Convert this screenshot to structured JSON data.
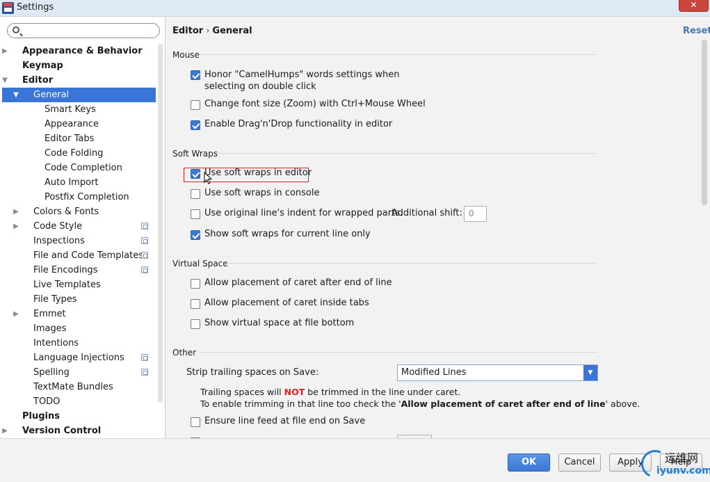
{
  "window": {
    "title": "Settings",
    "close_label": "✕"
  },
  "search": {
    "placeholder": ""
  },
  "tree": {
    "items": [
      {
        "label": "Appearance & Behavior",
        "arrow": "▶",
        "bold": true,
        "indent": 0,
        "project": false
      },
      {
        "label": "Keymap",
        "arrow": "",
        "bold": true,
        "indent": 0,
        "project": false
      },
      {
        "label": "Editor",
        "arrow": "▼",
        "bold": true,
        "indent": 0,
        "project": false
      },
      {
        "label": "General",
        "arrow": "▼",
        "bold": false,
        "indent": 1,
        "project": false,
        "selected": true
      },
      {
        "label": "Smart Keys",
        "arrow": "",
        "bold": false,
        "indent": 2,
        "project": false
      },
      {
        "label": "Appearance",
        "arrow": "",
        "bold": false,
        "indent": 2,
        "project": false
      },
      {
        "label": "Editor Tabs",
        "arrow": "",
        "bold": false,
        "indent": 2,
        "project": false
      },
      {
        "label": "Code Folding",
        "arrow": "",
        "bold": false,
        "indent": 2,
        "project": false
      },
      {
        "label": "Code Completion",
        "arrow": "",
        "bold": false,
        "indent": 2,
        "project": false
      },
      {
        "label": "Auto Import",
        "arrow": "",
        "bold": false,
        "indent": 2,
        "project": false
      },
      {
        "label": "Postfix Completion",
        "arrow": "",
        "bold": false,
        "indent": 2,
        "project": false
      },
      {
        "label": "Colors & Fonts",
        "arrow": "▶",
        "bold": false,
        "indent": 1,
        "project": false
      },
      {
        "label": "Code Style",
        "arrow": "▶",
        "bold": false,
        "indent": 1,
        "project": true
      },
      {
        "label": "Inspections",
        "arrow": "",
        "bold": false,
        "indent": 1,
        "project": true
      },
      {
        "label": "File and Code Templates",
        "arrow": "",
        "bold": false,
        "indent": 1,
        "project": true
      },
      {
        "label": "File Encodings",
        "arrow": "",
        "bold": false,
        "indent": 1,
        "project": true
      },
      {
        "label": "Live Templates",
        "arrow": "",
        "bold": false,
        "indent": 1,
        "project": false
      },
      {
        "label": "File Types",
        "arrow": "",
        "bold": false,
        "indent": 1,
        "project": false
      },
      {
        "label": "Emmet",
        "arrow": "▶",
        "bold": false,
        "indent": 1,
        "project": false
      },
      {
        "label": "Images",
        "arrow": "",
        "bold": false,
        "indent": 1,
        "project": false
      },
      {
        "label": "Intentions",
        "arrow": "",
        "bold": false,
        "indent": 1,
        "project": false
      },
      {
        "label": "Language Injections",
        "arrow": "",
        "bold": false,
        "indent": 1,
        "project": true
      },
      {
        "label": "Spelling",
        "arrow": "",
        "bold": false,
        "indent": 1,
        "project": true
      },
      {
        "label": "TextMate Bundles",
        "arrow": "",
        "bold": false,
        "indent": 1,
        "project": false
      },
      {
        "label": "TODO",
        "arrow": "",
        "bold": false,
        "indent": 1,
        "project": false
      },
      {
        "label": "Plugins",
        "arrow": "",
        "bold": true,
        "indent": 0,
        "project": false
      },
      {
        "label": "Version Control",
        "arrow": "▶",
        "bold": true,
        "indent": 0,
        "project": false
      }
    ]
  },
  "header": {
    "crumb_parent": "Editor",
    "crumb_sep": "›",
    "crumb_current": "General",
    "reset_label": "Reset"
  },
  "mouse": {
    "title": "Mouse",
    "camel_humps": {
      "label": "Honor \"CamelHumps\" words settings when selecting on double click",
      "checked": true
    },
    "zoom": {
      "label": "Change font size (Zoom) with Ctrl+Mouse Wheel",
      "checked": false
    },
    "drag_drop": {
      "label": "Enable Drag'n'Drop functionality in editor",
      "checked": true
    }
  },
  "soft_wraps": {
    "title": "Soft Wraps",
    "editor": {
      "label": "Use soft wraps in editor",
      "checked": true
    },
    "console": {
      "label": "Use soft wraps in console",
      "checked": false
    },
    "indent": {
      "label": "Use original line's indent for wrapped parts.",
      "checked": false
    },
    "additional_shift_label": "Additional shift:",
    "additional_shift_value": "0",
    "current_line": {
      "label": "Show soft wraps for current line only",
      "checked": true
    }
  },
  "virtual_space": {
    "title": "Virtual Space",
    "after_eol": {
      "label": "Allow placement of caret after end of line",
      "checked": false
    },
    "inside_tabs": {
      "label": "Allow placement of caret inside tabs",
      "checked": false
    },
    "file_bottom": {
      "label": "Show virtual space at file bottom",
      "checked": false
    }
  },
  "other": {
    "title": "Other",
    "strip_label": "Strip trailing spaces on Save:",
    "strip_value": "Modified Lines",
    "info_line1_a": "Trailing spaces will ",
    "info_line1_not": "NOT",
    "info_line1_b": " be trimmed in the line under caret.",
    "info_line2_a": "To enable trimming in that line too check the '",
    "info_line2_bold": "Allow placement of caret after end of line",
    "info_line2_b": "' above.",
    "line_feed": {
      "label": "Ensure line feed at file end on Save",
      "checked": false
    }
  },
  "buttons": {
    "ok": "OK",
    "cancel": "Cancel",
    "apply": "Apply",
    "help": "Help"
  },
  "watermark": {
    "cn": "运维网",
    "en": "iyunv.com"
  },
  "colors": {
    "accent": "#3875d7",
    "selected_row": "#3875d7",
    "link": "#4a77b4",
    "warning": "#e02020"
  }
}
